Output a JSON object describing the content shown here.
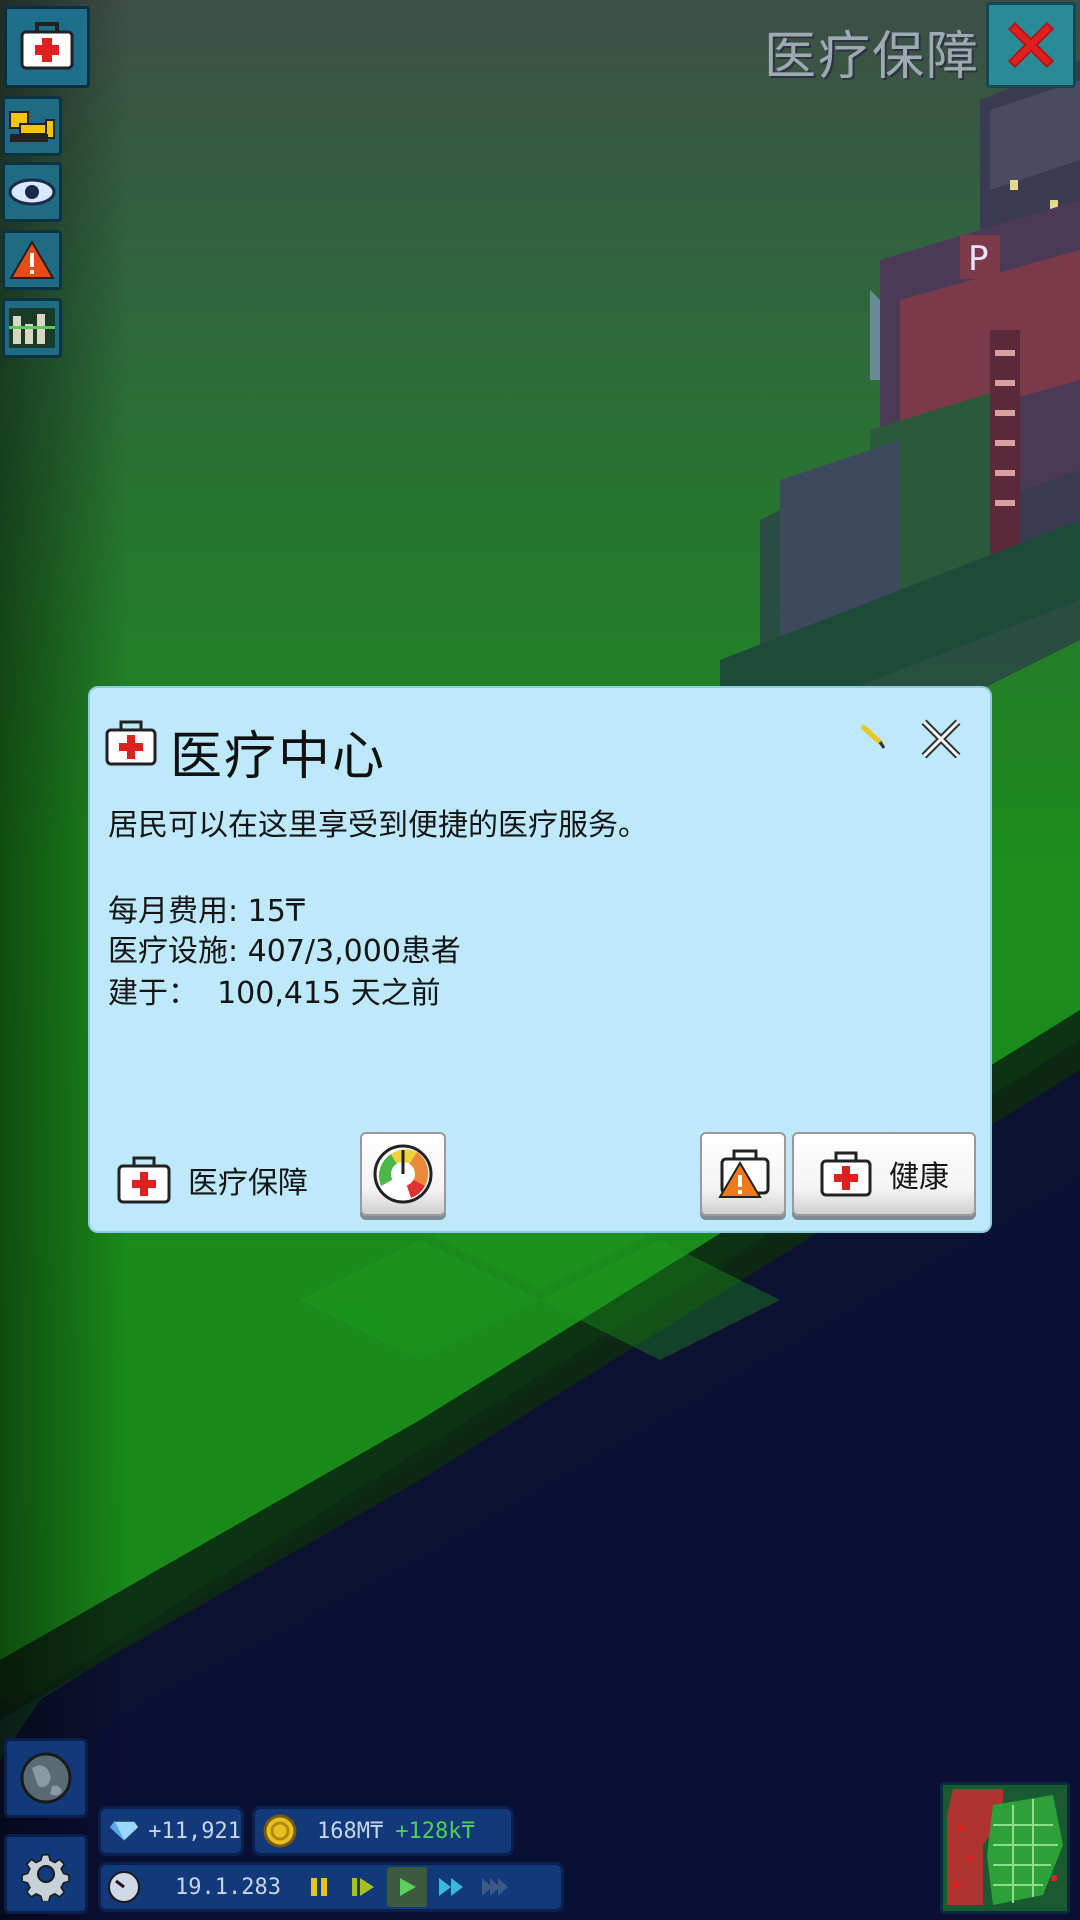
{
  "overlay": {
    "title": "医疗保障",
    "close_icon": "close-x-icon"
  },
  "tools": [
    {
      "name": "medical-tool",
      "icon": "medical-kit-icon"
    },
    {
      "name": "bulldozer-tool",
      "icon": "bulldozer-icon"
    },
    {
      "name": "view-tool",
      "icon": "eye-icon"
    },
    {
      "name": "warning-tool",
      "icon": "warning-icon"
    },
    {
      "name": "budget-tool",
      "icon": "bars-icon"
    }
  ],
  "panel": {
    "title": "医疗中心",
    "description": "居民可以在这里享受到便捷的医疗服务。",
    "cost_label": "每月费用:",
    "cost_value": "15",
    "currency_symbol": "₸",
    "capacity_label": "医疗设施:",
    "capacity_value": "407/3,000",
    "capacity_unit": "患者",
    "built_label": "建于：",
    "built_value": "100,415",
    "built_unit": "天之前",
    "category_label": "医疗保障",
    "health_button_label": "健康"
  },
  "hud": {
    "diamonds": "+11,921",
    "money": "168M₸",
    "income": "+128k₸",
    "date": "19.1.283"
  },
  "colors": {
    "panel_bg": "#bde9fb",
    "grass": "#1b8a1b",
    "hud_bg": "#12397a",
    "accent_red": "#e02020"
  }
}
